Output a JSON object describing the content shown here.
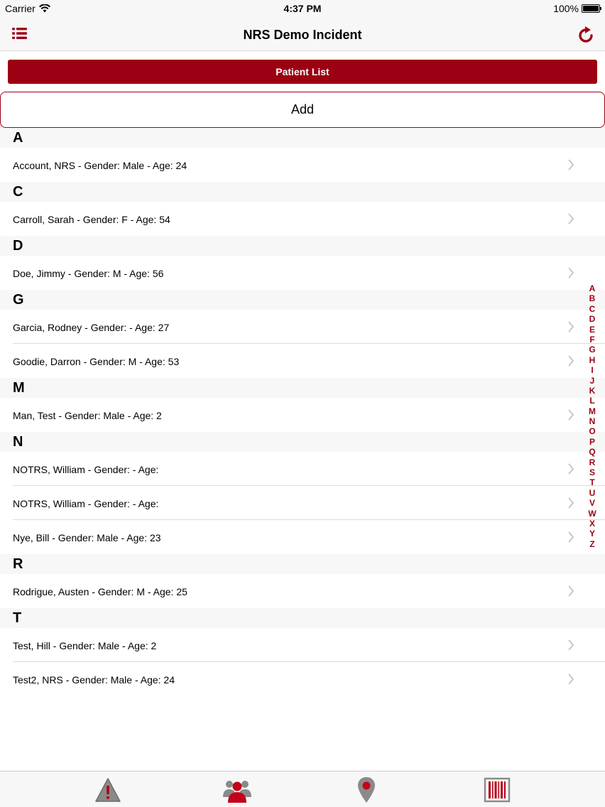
{
  "status_bar": {
    "carrier": "Carrier",
    "time": "4:37 PM",
    "battery": "100%"
  },
  "nav": {
    "title": "NRS Demo Incident",
    "menu_icon": "list-icon",
    "refresh_icon": "refresh-icon"
  },
  "segment": {
    "label": "Patient List"
  },
  "add_button": {
    "label": "Add"
  },
  "sections": [
    {
      "letter": "A",
      "rows": [
        "Account, NRS - Gender: Male - Age: 24"
      ]
    },
    {
      "letter": "C",
      "rows": [
        "Carroll, Sarah - Gender: F - Age: 54"
      ]
    },
    {
      "letter": "D",
      "rows": [
        "Doe, Jimmy - Gender: M - Age: 56"
      ]
    },
    {
      "letter": "G",
      "rows": [
        "Garcia, Rodney - Gender: - Age: 27",
        "Goodie, Darron - Gender: M - Age: 53"
      ]
    },
    {
      "letter": "M",
      "rows": [
        "Man, Test - Gender: Male - Age: 2"
      ]
    },
    {
      "letter": "N",
      "rows": [
        "NOTRS, William - Gender: - Age:",
        "NOTRS, William - Gender: - Age:",
        "Nye, Bill - Gender: Male - Age: 23"
      ]
    },
    {
      "letter": "R",
      "rows": [
        "Rodrigue, Austen - Gender: M - Age: 25"
      ]
    },
    {
      "letter": "T",
      "rows": [
        "Test, Hill - Gender: Male - Age: 2",
        "Test2, NRS - Gender: Male - Age: 24"
      ]
    }
  ],
  "index_letters": [
    "A",
    "B",
    "C",
    "D",
    "E",
    "F",
    "G",
    "H",
    "I",
    "J",
    "K",
    "L",
    "M",
    "N",
    "O",
    "P",
    "Q",
    "R",
    "S",
    "T",
    "U",
    "V",
    "W",
    "X",
    "Y",
    "Z"
  ],
  "tabs": [
    {
      "icon": "warning-icon"
    },
    {
      "icon": "patients-icon"
    },
    {
      "icon": "location-pin-icon"
    },
    {
      "icon": "barcode-icon"
    }
  ],
  "colors": {
    "accent": "#9c0013",
    "bar_bg": "#f7f7f7",
    "icon_gray": "#8a8a8a"
  }
}
